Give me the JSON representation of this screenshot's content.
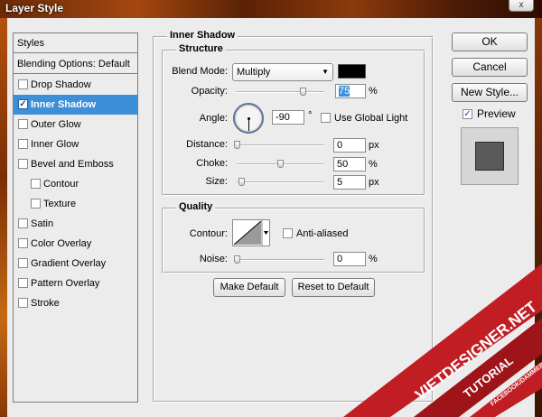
{
  "window": {
    "title": "Layer Style",
    "close_glyph": "x"
  },
  "styles_list": {
    "header": "Styles",
    "blending": "Blending Options: Default",
    "items": [
      {
        "label": "Drop Shadow",
        "checked": false,
        "sub": false
      },
      {
        "label": "Inner Shadow",
        "checked": true,
        "sub": false
      },
      {
        "label": "Outer Glow",
        "checked": false,
        "sub": false
      },
      {
        "label": "Inner Glow",
        "checked": false,
        "sub": false
      },
      {
        "label": "Bevel and Emboss",
        "checked": false,
        "sub": false
      },
      {
        "label": "Contour",
        "checked": false,
        "sub": true
      },
      {
        "label": "Texture",
        "checked": false,
        "sub": true
      },
      {
        "label": "Satin",
        "checked": false,
        "sub": false
      },
      {
        "label": "Color Overlay",
        "checked": false,
        "sub": false
      },
      {
        "label": "Gradient Overlay",
        "checked": false,
        "sub": false
      },
      {
        "label": "Pattern Overlay",
        "checked": false,
        "sub": false
      },
      {
        "label": "Stroke",
        "checked": false,
        "sub": false
      }
    ]
  },
  "panel": {
    "title": "Inner Shadow",
    "structure": {
      "title": "Structure",
      "blend_mode_label": "Blend Mode:",
      "blend_mode_value": "Multiply",
      "swatch_color": "#000000",
      "opacity_label": "Opacity:",
      "opacity_value": "75",
      "opacity_unit": "%",
      "angle_label": "Angle:",
      "angle_value": "-90",
      "angle_unit": "°",
      "global_light_label": "Use Global Light",
      "distance_label": "Distance:",
      "distance_value": "0",
      "distance_unit": "px",
      "choke_label": "Choke:",
      "choke_value": "50",
      "choke_unit": "%",
      "size_label": "Size:",
      "size_value": "5",
      "size_unit": "px"
    },
    "quality": {
      "title": "Quality",
      "contour_label": "Contour:",
      "antialiased_label": "Anti-aliased",
      "noise_label": "Noise:",
      "noise_value": "0",
      "noise_unit": "%"
    },
    "buttons": {
      "make_default": "Make Default",
      "reset_default": "Reset to Default"
    }
  },
  "actions": {
    "ok": "OK",
    "cancel": "Cancel",
    "new_style": "New Style...",
    "preview": "Preview",
    "preview_checked": true
  },
  "watermark": {
    "site": "VIETDESIGNER.NET",
    "tag": "TUTORIAL",
    "fb": "FACEBOOK/DAMMEPS"
  }
}
